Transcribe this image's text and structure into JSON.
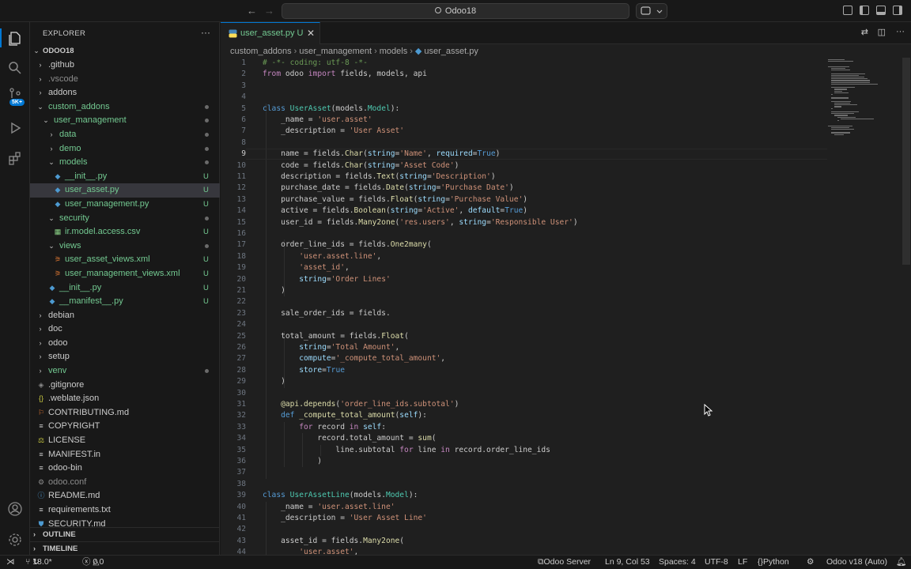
{
  "titlebar": {
    "search_text": "Odoo18"
  },
  "activity": {
    "badge": "5K+"
  },
  "explorer": {
    "title": "EXPLORER",
    "more": "···",
    "root": "ODOO18",
    "items": [
      {
        "label": ".github",
        "depth": 1,
        "type": "folder",
        "chev": "›",
        "color": "#cccccc",
        "status": ""
      },
      {
        "label": ".vscode",
        "depth": 1,
        "type": "folder",
        "chev": "›",
        "color": "#8b8b8b",
        "status": ""
      },
      {
        "label": "addons",
        "depth": 1,
        "type": "folder",
        "chev": "›",
        "color": "#cccccc",
        "status": ""
      },
      {
        "label": "custom_addons",
        "depth": 1,
        "type": "folder",
        "chev": "⌄",
        "color": "#73c991",
        "status": "dot"
      },
      {
        "label": "user_management",
        "depth": 2,
        "type": "folder",
        "chev": "⌄",
        "color": "#73c991",
        "status": "dot"
      },
      {
        "label": "data",
        "depth": 3,
        "type": "folder",
        "chev": "›",
        "color": "#73c991",
        "status": "dot"
      },
      {
        "label": "demo",
        "depth": 3,
        "type": "folder",
        "chev": "›",
        "color": "#73c991",
        "status": "dot"
      },
      {
        "label": "models",
        "depth": 3,
        "type": "folder",
        "chev": "⌄",
        "color": "#73c991",
        "status": "dot"
      },
      {
        "label": "__init__.py",
        "depth": 4,
        "type": "py",
        "chev": "",
        "color": "#73c991",
        "status": "U"
      },
      {
        "label": "user_asset.py",
        "depth": 4,
        "type": "py",
        "chev": "",
        "color": "#73c991",
        "status": "U",
        "selected": true
      },
      {
        "label": "user_management.py",
        "depth": 4,
        "type": "py",
        "chev": "",
        "color": "#73c991",
        "status": "U"
      },
      {
        "label": "security",
        "depth": 3,
        "type": "folder",
        "chev": "⌄",
        "color": "#73c991",
        "status": "dot"
      },
      {
        "label": "ir.model.access.csv",
        "depth": 4,
        "type": "csv",
        "chev": "",
        "color": "#73c991",
        "status": "U"
      },
      {
        "label": "views",
        "depth": 3,
        "type": "folder",
        "chev": "⌄",
        "color": "#73c991",
        "status": "dot"
      },
      {
        "label": "user_asset_views.xml",
        "depth": 4,
        "type": "xml",
        "chev": "",
        "color": "#73c991",
        "status": "U"
      },
      {
        "label": "user_management_views.xml",
        "depth": 4,
        "type": "xml",
        "chev": "",
        "color": "#73c991",
        "status": "U"
      },
      {
        "label": "__init__.py",
        "depth": 3,
        "type": "py",
        "chev": "",
        "color": "#73c991",
        "status": "U"
      },
      {
        "label": "__manifest__.py",
        "depth": 3,
        "type": "py",
        "chev": "",
        "color": "#73c991",
        "status": "U"
      },
      {
        "label": "debian",
        "depth": 1,
        "type": "folder",
        "chev": "›",
        "color": "#cccccc",
        "status": ""
      },
      {
        "label": "doc",
        "depth": 1,
        "type": "folder",
        "chev": "›",
        "color": "#cccccc",
        "status": ""
      },
      {
        "label": "odoo",
        "depth": 1,
        "type": "folder",
        "chev": "›",
        "color": "#cccccc",
        "status": ""
      },
      {
        "label": "setup",
        "depth": 1,
        "type": "folder",
        "chev": "›",
        "color": "#cccccc",
        "status": ""
      },
      {
        "label": "venv",
        "depth": 1,
        "type": "folder",
        "chev": "›",
        "color": "#73c991",
        "status": "dot"
      },
      {
        "label": ".gitignore",
        "depth": 1,
        "type": "git",
        "chev": "",
        "color": "#cccccc",
        "status": ""
      },
      {
        "label": ".weblate.json",
        "depth": 1,
        "type": "json",
        "chev": "",
        "color": "#cccccc",
        "status": ""
      },
      {
        "label": "CONTRIBUTING.md",
        "depth": 1,
        "type": "md",
        "chev": "",
        "color": "#cccccc",
        "status": ""
      },
      {
        "label": "COPYRIGHT",
        "depth": 1,
        "type": "txt",
        "chev": "",
        "color": "#cccccc",
        "status": ""
      },
      {
        "label": "LICENSE",
        "depth": 1,
        "type": "lic",
        "chev": "",
        "color": "#cccccc",
        "status": ""
      },
      {
        "label": "MANIFEST.in",
        "depth": 1,
        "type": "txt",
        "chev": "",
        "color": "#cccccc",
        "status": ""
      },
      {
        "label": "odoo-bin",
        "depth": 1,
        "type": "txt",
        "chev": "",
        "color": "#cccccc",
        "status": ""
      },
      {
        "label": "odoo.conf",
        "depth": 1,
        "type": "conf",
        "chev": "",
        "color": "#8b8b8b",
        "status": ""
      },
      {
        "label": "README.md",
        "depth": 1,
        "type": "info",
        "chev": "",
        "color": "#cccccc",
        "status": ""
      },
      {
        "label": "requirements.txt",
        "depth": 1,
        "type": "txt",
        "chev": "",
        "color": "#cccccc",
        "status": ""
      },
      {
        "label": "SECURITY.md",
        "depth": 1,
        "type": "sec",
        "chev": "",
        "color": "#cccccc",
        "status": ""
      }
    ],
    "outline": "OUTLINE",
    "timeline": "TIMELINE"
  },
  "editor": {
    "tab_label": "user_asset.py",
    "tab_status": "U",
    "breadcrumbs": [
      "custom_addons",
      "user_management",
      "models",
      "user_asset.py"
    ],
    "current_line": 9,
    "lines": [
      [
        [
          "cm",
          "# -*- coding: utf-8 -*-"
        ]
      ],
      [
        [
          "kwc",
          "from"
        ],
        [
          "t",
          " odoo "
        ],
        [
          "kwc",
          "import"
        ],
        [
          "t",
          " fields, models, api"
        ]
      ],
      [],
      [],
      [
        [
          "kw",
          "class"
        ],
        [
          "t",
          " "
        ],
        [
          "cls",
          "UserAsset"
        ],
        [
          "t",
          "(models."
        ],
        [
          "cls",
          "Model"
        ],
        [
          "t",
          "):"
        ]
      ],
      [
        [
          "t",
          "    _name = "
        ],
        [
          "str",
          "'user.asset'"
        ]
      ],
      [
        [
          "t",
          "    _description = "
        ],
        [
          "str",
          "'User Asset'"
        ]
      ],
      [],
      [
        [
          "t",
          "    name = fields."
        ],
        [
          "fn",
          "Char"
        ],
        [
          "t",
          "("
        ],
        [
          "par",
          "string"
        ],
        [
          "t",
          "="
        ],
        [
          "str",
          "'Name'"
        ],
        [
          "t",
          ", "
        ],
        [
          "par",
          "required"
        ],
        [
          "t",
          "="
        ],
        [
          "bool",
          "True"
        ],
        [
          "t",
          ")"
        ]
      ],
      [
        [
          "t",
          "    code = fields."
        ],
        [
          "fn",
          "Char"
        ],
        [
          "t",
          "("
        ],
        [
          "par",
          "string"
        ],
        [
          "t",
          "="
        ],
        [
          "str",
          "'Asset Code'"
        ],
        [
          "t",
          ")"
        ]
      ],
      [
        [
          "t",
          "    description = fields."
        ],
        [
          "fn",
          "Text"
        ],
        [
          "t",
          "("
        ],
        [
          "par",
          "string"
        ],
        [
          "t",
          "="
        ],
        [
          "str",
          "'Description'"
        ],
        [
          "t",
          ")"
        ]
      ],
      [
        [
          "t",
          "    purchase_date = fields."
        ],
        [
          "fn",
          "Date"
        ],
        [
          "t",
          "("
        ],
        [
          "par",
          "string"
        ],
        [
          "t",
          "="
        ],
        [
          "str",
          "'Purchase Date'"
        ],
        [
          "t",
          ")"
        ]
      ],
      [
        [
          "t",
          "    purchase_value = fields."
        ],
        [
          "fn",
          "Float"
        ],
        [
          "t",
          "("
        ],
        [
          "par",
          "string"
        ],
        [
          "t",
          "="
        ],
        [
          "str",
          "'Purchase Value'"
        ],
        [
          "t",
          ")"
        ]
      ],
      [
        [
          "t",
          "    active = fields."
        ],
        [
          "fn",
          "Boolean"
        ],
        [
          "t",
          "("
        ],
        [
          "par",
          "string"
        ],
        [
          "t",
          "="
        ],
        [
          "str",
          "'Active'"
        ],
        [
          "t",
          ", "
        ],
        [
          "par",
          "default"
        ],
        [
          "t",
          "="
        ],
        [
          "bool",
          "True"
        ],
        [
          "t",
          ")"
        ]
      ],
      [
        [
          "t",
          "    user_id = fields."
        ],
        [
          "fn",
          "Many2one"
        ],
        [
          "t",
          "("
        ],
        [
          "str",
          "'res.users'"
        ],
        [
          "t",
          ", "
        ],
        [
          "par",
          "string"
        ],
        [
          "t",
          "="
        ],
        [
          "str",
          "'Responsible User'"
        ],
        [
          "t",
          ")"
        ]
      ],
      [],
      [
        [
          "t",
          "    order_line_ids = fields."
        ],
        [
          "fn",
          "One2many"
        ],
        [
          "t",
          "("
        ]
      ],
      [
        [
          "t",
          "        "
        ],
        [
          "str",
          "'user.asset.line'"
        ],
        [
          "t",
          ","
        ]
      ],
      [
        [
          "t",
          "        "
        ],
        [
          "str",
          "'asset_id'"
        ],
        [
          "t",
          ","
        ]
      ],
      [
        [
          "t",
          "        "
        ],
        [
          "par",
          "string"
        ],
        [
          "t",
          "="
        ],
        [
          "str",
          "'Order Lines'"
        ]
      ],
      [
        [
          "t",
          "    )"
        ]
      ],
      [],
      [
        [
          "t",
          "    sale_order_ids = fields."
        ]
      ],
      [],
      [
        [
          "t",
          "    total_amount = fields."
        ],
        [
          "fn",
          "Float"
        ],
        [
          "t",
          "("
        ]
      ],
      [
        [
          "t",
          "        "
        ],
        [
          "par",
          "string"
        ],
        [
          "t",
          "="
        ],
        [
          "str",
          "'Total Amount'"
        ],
        [
          "t",
          ","
        ]
      ],
      [
        [
          "t",
          "        "
        ],
        [
          "par",
          "compute"
        ],
        [
          "t",
          "="
        ],
        [
          "str",
          "'_compute_total_amount'"
        ],
        [
          "t",
          ","
        ]
      ],
      [
        [
          "t",
          "        "
        ],
        [
          "par",
          "store"
        ],
        [
          "t",
          "="
        ],
        [
          "bool",
          "True"
        ]
      ],
      [
        [
          "t",
          "    )"
        ]
      ],
      [],
      [
        [
          "t",
          "    "
        ],
        [
          "dec",
          "@api.depends"
        ],
        [
          "t",
          "("
        ],
        [
          "str",
          "'order_line_ids.subtotal'"
        ],
        [
          "t",
          ")"
        ]
      ],
      [
        [
          "t",
          "    "
        ],
        [
          "kw",
          "def"
        ],
        [
          "t",
          " "
        ],
        [
          "fn",
          "_compute_total_amount"
        ],
        [
          "t",
          "("
        ],
        [
          "par",
          "self"
        ],
        [
          "t",
          "):"
        ]
      ],
      [
        [
          "t",
          "        "
        ],
        [
          "kwc",
          "for"
        ],
        [
          "t",
          " record "
        ],
        [
          "kwc",
          "in"
        ],
        [
          "t",
          " "
        ],
        [
          "par",
          "self"
        ],
        [
          "t",
          ":"
        ]
      ],
      [
        [
          "t",
          "            record.total_amount = "
        ],
        [
          "fn",
          "sum"
        ],
        [
          "t",
          "("
        ]
      ],
      [
        [
          "t",
          "                line.subtotal "
        ],
        [
          "kwc",
          "for"
        ],
        [
          "t",
          " line "
        ],
        [
          "kwc",
          "in"
        ],
        [
          "t",
          " record.order_line_ids"
        ]
      ],
      [
        [
          "t",
          "            )"
        ]
      ],
      [],
      [],
      [
        [
          "kw",
          "class"
        ],
        [
          "t",
          " "
        ],
        [
          "cls",
          "UserAssetLine"
        ],
        [
          "t",
          "(models."
        ],
        [
          "cls",
          "Model"
        ],
        [
          "t",
          "):"
        ]
      ],
      [
        [
          "t",
          "    _name = "
        ],
        [
          "str",
          "'user.asset.line'"
        ]
      ],
      [
        [
          "t",
          "    _description = "
        ],
        [
          "str",
          "'User Asset Line'"
        ]
      ],
      [],
      [
        [
          "t",
          "    asset_id = fields."
        ],
        [
          "fn",
          "Many2one"
        ],
        [
          "t",
          "("
        ]
      ],
      [
        [
          "t",
          "        "
        ],
        [
          "str",
          "'user.asset'"
        ],
        [
          "t",
          ","
        ]
      ]
    ]
  },
  "status": {
    "remote": "18.0*",
    "errors": "0",
    "warnings": "0",
    "server": "Odoo Server",
    "position": "Ln 9, Col 53",
    "spaces": "Spaces: 4",
    "encoding": "UTF-8",
    "eol": "LF",
    "language": "Python",
    "odoo_version": "Odoo v18 (Auto)"
  }
}
